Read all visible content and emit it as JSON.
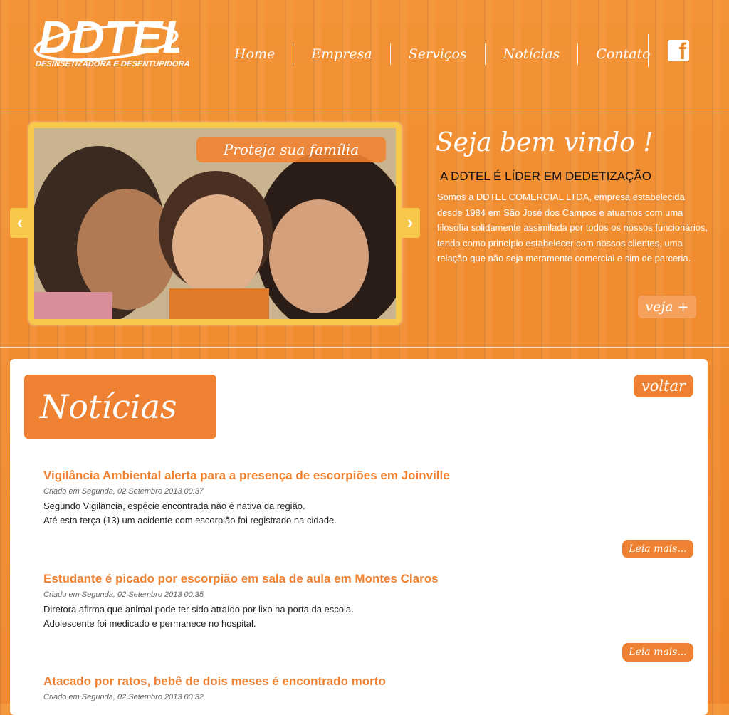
{
  "header": {
    "logo_text": "DDTEL",
    "logo_tagline": "DESINSETIZADORA E DESENTUPIDORA",
    "nav": [
      "Home",
      "Empresa",
      "Serviços",
      "Notícias",
      "Contato"
    ],
    "social_icon": "facebook-icon"
  },
  "banner": {
    "slide_caption": "Proteja sua família",
    "prev_arrow": "‹",
    "next_arrow": "›",
    "welcome_title": "Seja bem vindo !",
    "welcome_subtitle": "A DDTEL É LÍDER EM DEDETIZAÇÃO",
    "welcome_text": "Somos a DDTEL COMERCIAL LTDA, empresa estabelecida desde 1984 em São José dos Campos e atuamos com uma filosofia solidamente assimilada por todos os nossos funcionários, tendo como princípio estabelecer com nossos clientes, uma relação que não seja meramente comercial e sim de parceria.",
    "more_label": "veja +"
  },
  "news": {
    "heading": "Notícias",
    "back_label": "voltar",
    "read_more_label": "Leia mais...",
    "articles": [
      {
        "title": "Vigilância Ambiental alerta para a presença de escorpiões em Joinville",
        "date": "Criado em Segunda, 02 Setembro 2013 00:37",
        "line1": "Segundo Vigilância, espécie encontrada não é nativa da região.",
        "line2": "Até esta terça (13) um acidente com escorpião foi registrado na cidade."
      },
      {
        "title": "Estudante é picado por escorpião em sala de aula em Montes Claros",
        "date": "Criado em Segunda, 02 Setembro 2013 00:35",
        "line1": "Diretora afirma que animal pode ter sido atraído por lixo na porta da escola.",
        "line2": "Adolescente foi medicado e permanece no hospital."
      },
      {
        "title": "Atacado por ratos, bebê de dois meses é encontrado morto",
        "date": "Criado em Segunda, 02 Setembro 2013 00:32"
      }
    ]
  },
  "colors": {
    "brand_orange": "#ef8232",
    "frame_yellow": "#f7c84a"
  }
}
